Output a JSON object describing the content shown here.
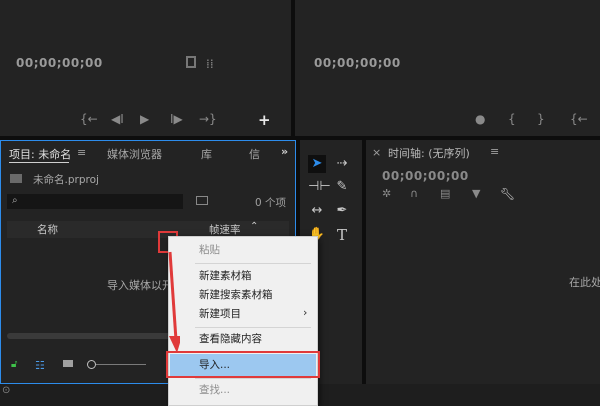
{
  "source_monitor": {
    "timecode": "00;00;00;00"
  },
  "program_monitor": {
    "timecode": "00;00;00;00"
  },
  "project_panel": {
    "tab_label": "项目: 未命名",
    "tabs": [
      "媒体浏览器",
      "库",
      "信"
    ],
    "file_name": "未命名.prproj",
    "item_count": "0 个项",
    "columns": {
      "name": "名称",
      "fps": "帧速率"
    },
    "empty_text": "导入媒体以开"
  },
  "timeline": {
    "tab_label": "时间轴: (无序列)",
    "timecode": "00;00;00;00",
    "empty_text": "在此处"
  },
  "context_menu": {
    "paste": "粘贴",
    "new_bin": "新建素材箱",
    "new_search_bin": "新建搜索素材箱",
    "new_item": "新建项目",
    "show_hidden": "查看隐藏内容",
    "import": "导入...",
    "find": "查找..."
  },
  "colors": {
    "accent_blue": "#2d8ceb",
    "highlight_red": "#e03a3a",
    "menu_highlight": "#9cc8f0"
  },
  "icons": {
    "monitor_controls": [
      "mark-in",
      "step-back",
      "play",
      "step-forward",
      "mark-out",
      "add"
    ],
    "tools": [
      "selection",
      "track-select",
      "ripple-edit",
      "razor",
      "slip",
      "pen",
      "hand",
      "type"
    ]
  }
}
